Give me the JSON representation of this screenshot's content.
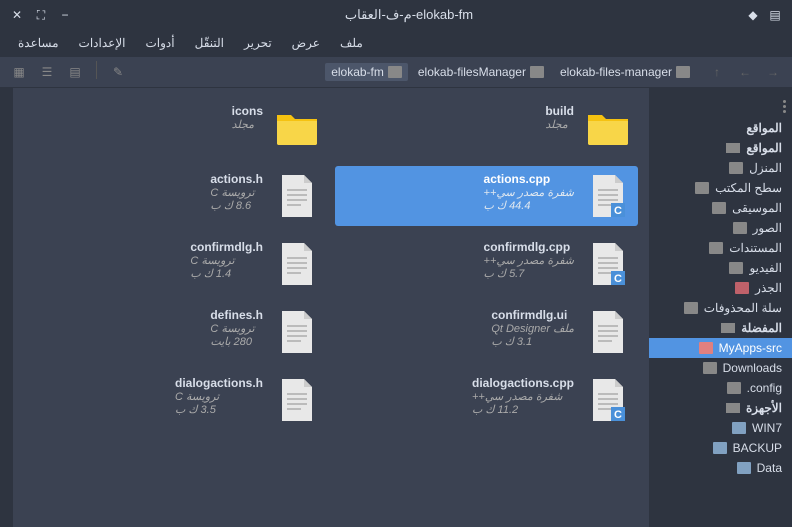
{
  "window": {
    "title": "م-ف-العقاب-elokab-fm"
  },
  "menu": {
    "items": [
      "ملف",
      "عرض",
      "تحرير",
      "التنقّل",
      "أدوات",
      "الإعدادات",
      "مساعدة"
    ]
  },
  "breadcrumbs": [
    {
      "label": "elokab-files-manager"
    },
    {
      "label": "elokab-filesManager"
    },
    {
      "label": "elokab-fm",
      "active": true
    }
  ],
  "sidebar": {
    "header": "المواقع",
    "sections": [
      {
        "title": "المواقع",
        "items": [
          {
            "label": "المنزل",
            "icon": "home"
          },
          {
            "label": "سطح المكتب",
            "icon": "folder"
          },
          {
            "label": "الموسيقى",
            "icon": "music"
          },
          {
            "label": "الصور",
            "icon": "picture"
          },
          {
            "label": "المستندات",
            "icon": "folder"
          },
          {
            "label": "الفيديو",
            "icon": "video"
          },
          {
            "label": "الجذر",
            "icon": "folder-red"
          },
          {
            "label": "سلة المحذوفات",
            "icon": "trash"
          }
        ]
      },
      {
        "title": "المفضلة",
        "items": [
          {
            "label": "MyApps-src",
            "icon": "folder-pink",
            "selected": true
          },
          {
            "label": "Downloads",
            "icon": "folder"
          },
          {
            "label": "config.",
            "icon": "folder"
          }
        ]
      },
      {
        "title": "الأجهزة",
        "items": [
          {
            "label": "WIN7",
            "icon": "disk"
          },
          {
            "label": "BACKUP",
            "icon": "disk"
          },
          {
            "label": "Data",
            "icon": "disk"
          }
        ]
      }
    ]
  },
  "files": [
    {
      "name": "build",
      "type": "مجلد",
      "size": "",
      "icon": "folder"
    },
    {
      "name": "icons",
      "type": "مجلد",
      "size": "",
      "icon": "folder"
    },
    {
      "name": "actions.cpp",
      "type": "شفرة مصدر سي++",
      "size": "44.4 ك ب",
      "icon": "cpp",
      "selected": true
    },
    {
      "name": "actions.h",
      "type": "ترويسة C",
      "size": "8.6 ك ب",
      "icon": "doc"
    },
    {
      "name": "confirmdlg.cpp",
      "type": "شفرة مصدر سي++",
      "size": "5.7 ك ب",
      "icon": "cpp"
    },
    {
      "name": "confirmdlg.h",
      "type": "ترويسة C",
      "size": "1.4 ك ب",
      "icon": "doc"
    },
    {
      "name": "confirmdlg.ui",
      "type": "ملف Qt Designer",
      "size": "3.1 ك ب",
      "icon": "doc"
    },
    {
      "name": "defines.h",
      "type": "ترويسة C",
      "size": "280 بايت",
      "icon": "doc"
    },
    {
      "name": "dialogactions.cpp",
      "type": "شفرة مصدر سي++",
      "size": "11.2 ك ب",
      "icon": "cpp"
    },
    {
      "name": "dialogactions.h",
      "type": "ترويسة C",
      "size": "3.5 ك ب",
      "icon": "doc"
    }
  ]
}
